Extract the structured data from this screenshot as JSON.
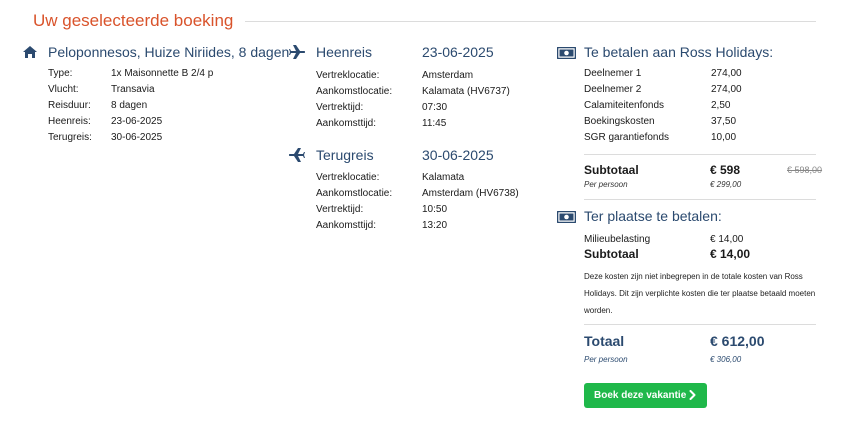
{
  "header": {
    "title": "Uw geselecteerde boeking"
  },
  "trip": {
    "title": "Peloponnesos, Huize Niriides, 8 dagen",
    "icon": "home-icon",
    "details": [
      {
        "label": "Type:",
        "value": "1x Maisonnette B 2/4 p"
      },
      {
        "label": "Vlucht:",
        "value": "Transavia"
      },
      {
        "label": "Reisduur:",
        "value": "8 dagen"
      },
      {
        "label": "Heenreis:",
        "value": "23-06-2025"
      },
      {
        "label": "Terugreis:",
        "value": "30-06-2025"
      }
    ]
  },
  "outbound": {
    "title": "Heenreis",
    "date": "23-06-2025",
    "icon": "plane-icon",
    "details": [
      {
        "label": "Vertreklocatie:",
        "value": "Amsterdam"
      },
      {
        "label": "Aankomstlocatie:",
        "value": "Kalamata (HV6737)"
      },
      {
        "label": "Vertrektijd:",
        "value": "07:30"
      },
      {
        "label": "Aankomsttijd:",
        "value": "11:45"
      }
    ]
  },
  "return": {
    "title": "Terugreis",
    "date": "30-06-2025",
    "icon": "plane-return-icon",
    "details": [
      {
        "label": "Vertreklocatie:",
        "value": "Kalamata"
      },
      {
        "label": "Aankomstlocatie:",
        "value": "Amsterdam (HV6738)"
      },
      {
        "label": "Vertrektijd:",
        "value": "10:50"
      },
      {
        "label": "Aankomsttijd:",
        "value": "13:20"
      }
    ]
  },
  "pay_ross": {
    "title": "Te betalen aan Ross Holidays:",
    "icon": "money-icon",
    "items": [
      {
        "label": "Deelnemer 1",
        "value": "274,00"
      },
      {
        "label": "Deelnemer 2",
        "value": "274,00"
      },
      {
        "label": "Calamiteitenfonds",
        "value": "2,50"
      },
      {
        "label": "Boekingskosten",
        "value": "37,50"
      },
      {
        "label": "SGR garantiefonds",
        "value": "10,00"
      }
    ],
    "subtotal_label": "Subtotaal",
    "subtotal_value": "€ 598",
    "old_price": "€ 598,00",
    "per_person_label": "Per persoon",
    "per_person_value": "€ 299,00"
  },
  "pay_local": {
    "title": "Ter plaatse te betalen:",
    "icon": "money-icon",
    "item_label": "Milieubelasting",
    "item_value": "€ 14,00",
    "subtotal_label": "Subtotaal",
    "subtotal_value": "€ 14,00",
    "note": "Deze kosten zijn niet inbegrepen in de totale kosten van Ross Holidays. Dit zijn verplichte kosten die ter plaatse betaald moeten worden."
  },
  "total": {
    "label": "Totaal",
    "value": "€ 612,00",
    "per_person_label": "Per persoon",
    "per_person_value": "€ 306,00"
  },
  "book_button": {
    "label": "Boek deze vakantie"
  },
  "colors": {
    "accent": "#d9532b",
    "heading": "#2b4a6f",
    "button": "#1fb84a"
  }
}
